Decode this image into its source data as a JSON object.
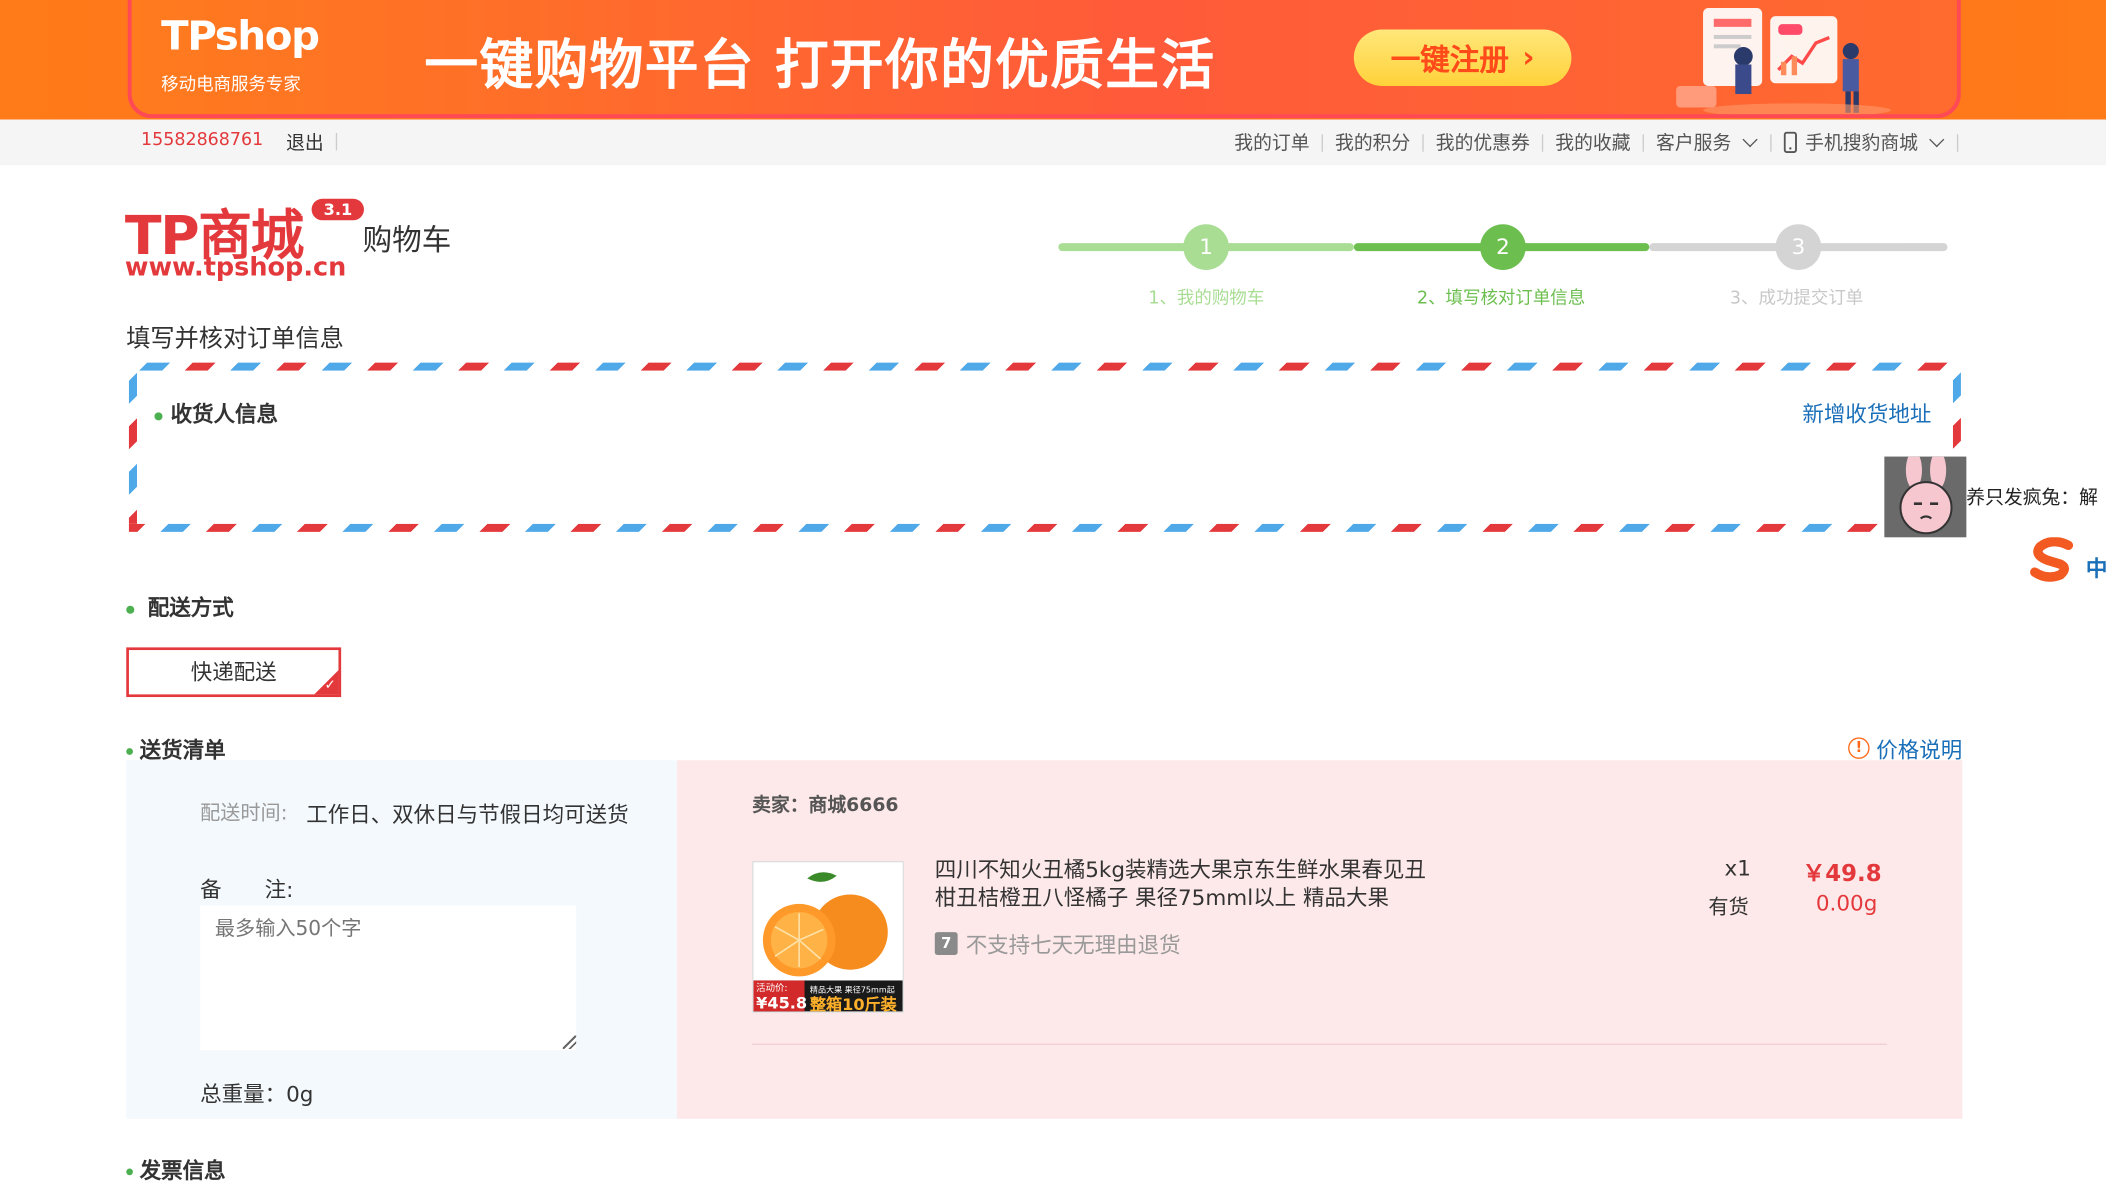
{
  "banner": {
    "logo_text": "TPshop",
    "logo_sub": "移动电商服务专家",
    "slogan": "一键购物平台 打开你的优质生活",
    "register_label": "一键注册",
    "register_arrow": "›",
    "close_icon": "close-icon"
  },
  "topnav": {
    "phone": "15582868761",
    "logout": "退出",
    "links": [
      "我的订单",
      "我的积分",
      "我的优惠券",
      "我的收藏",
      "客户服务",
      "手机搜豹商城"
    ]
  },
  "header": {
    "logo_text": "TP商城",
    "logo_version": "3.1",
    "logo_url": "www.tpshop.cn",
    "page_title": "购物车"
  },
  "steps": [
    {
      "num": "1",
      "label": "1、我的购物车"
    },
    {
      "num": "2",
      "label": "2、填写核对订单信息"
    },
    {
      "num": "3",
      "label": "3、成功提交订单"
    }
  ],
  "colors": {
    "accent": "#e4393c",
    "link": "#1a6fb8",
    "step_done": "#a9dd94",
    "step_active": "#6cbf4f",
    "step_todo": "#d4d4d4"
  },
  "order": {
    "section_title": "填写并核对订单信息",
    "receiver_title": "收货人信息",
    "new_address": "新增收货地址",
    "shipping_title": "配送方式",
    "shipping_option": "快递配送",
    "list_title": "送货清单",
    "price_note": "价格说明",
    "ship_time_label": "配送时间:",
    "ship_time_value": "工作日、双休日与节假日均可送货",
    "remark_label": "备　　注:",
    "remark_placeholder": "最多输入50个字",
    "total_weight": "总重量：0g",
    "seller": "卖家：商城6666",
    "invoice_title": "发票信息"
  },
  "product": {
    "name": "四川不知火丑橘5kg装精选大果京东生鲜水果春见丑柑丑桔橙丑八怪橘子 果径75mml以上 精品大果",
    "no_return": "不支持七天无理由退货",
    "no_return_icon": "7",
    "qty": "x1",
    "stock": "有货",
    "price": "￥49.8",
    "weight": "0.00g",
    "img_promo_label": "活动价:",
    "img_promo_price": "¥45.8",
    "img_tag": "精品大果 果径75mm起",
    "img_box": "整箱10斤装"
  },
  "side": {
    "text": "养只发疯兔：解",
    "zh": "中"
  }
}
